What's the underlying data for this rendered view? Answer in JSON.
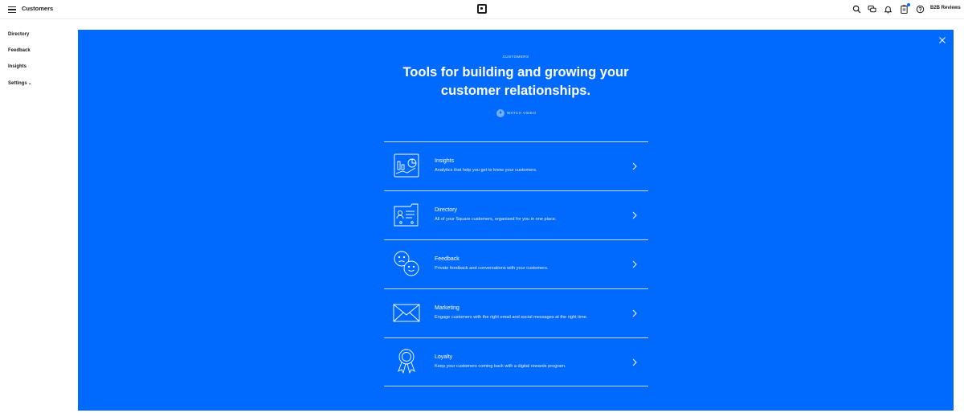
{
  "header": {
    "app_title": "Customers",
    "menu_icon": "hamburger-icon",
    "logo_icon": "square-logo-icon",
    "account_name": "B2B Reviews",
    "icons": [
      "search-icon",
      "chat-icon",
      "bell-icon",
      "clipboard-icon",
      "help-icon"
    ]
  },
  "sidebar": {
    "items": [
      {
        "label": "Directory"
      },
      {
        "label": "Feedback"
      },
      {
        "label": "Insights"
      },
      {
        "label": "Settings"
      }
    ]
  },
  "modal": {
    "background_color": "#006aff",
    "eyebrow": "CUSTOMERS",
    "headline_line1": "Tools for building and growing your",
    "headline_line2": "customer relationships.",
    "watch_label": "WATCH VIDEO",
    "close_icon": "close-icon",
    "tools": [
      {
        "title": "Insights",
        "description": "Analytics that help you get to know your customers.",
        "icon": "chart-icon"
      },
      {
        "title": "Directory",
        "description": "All of your Square customers, organized for you in one place.",
        "icon": "contact-card-icon"
      },
      {
        "title": "Feedback",
        "description": "Private feedback and conversations with your customers.",
        "icon": "faces-icon"
      },
      {
        "title": "Marketing",
        "description": "Engage customers with the right email and social messages at the right time.",
        "icon": "envelope-icon"
      },
      {
        "title": "Loyalty",
        "description": "Keep your customers coming back with a digital rewards program.",
        "icon": "award-ribbon-icon"
      }
    ]
  }
}
